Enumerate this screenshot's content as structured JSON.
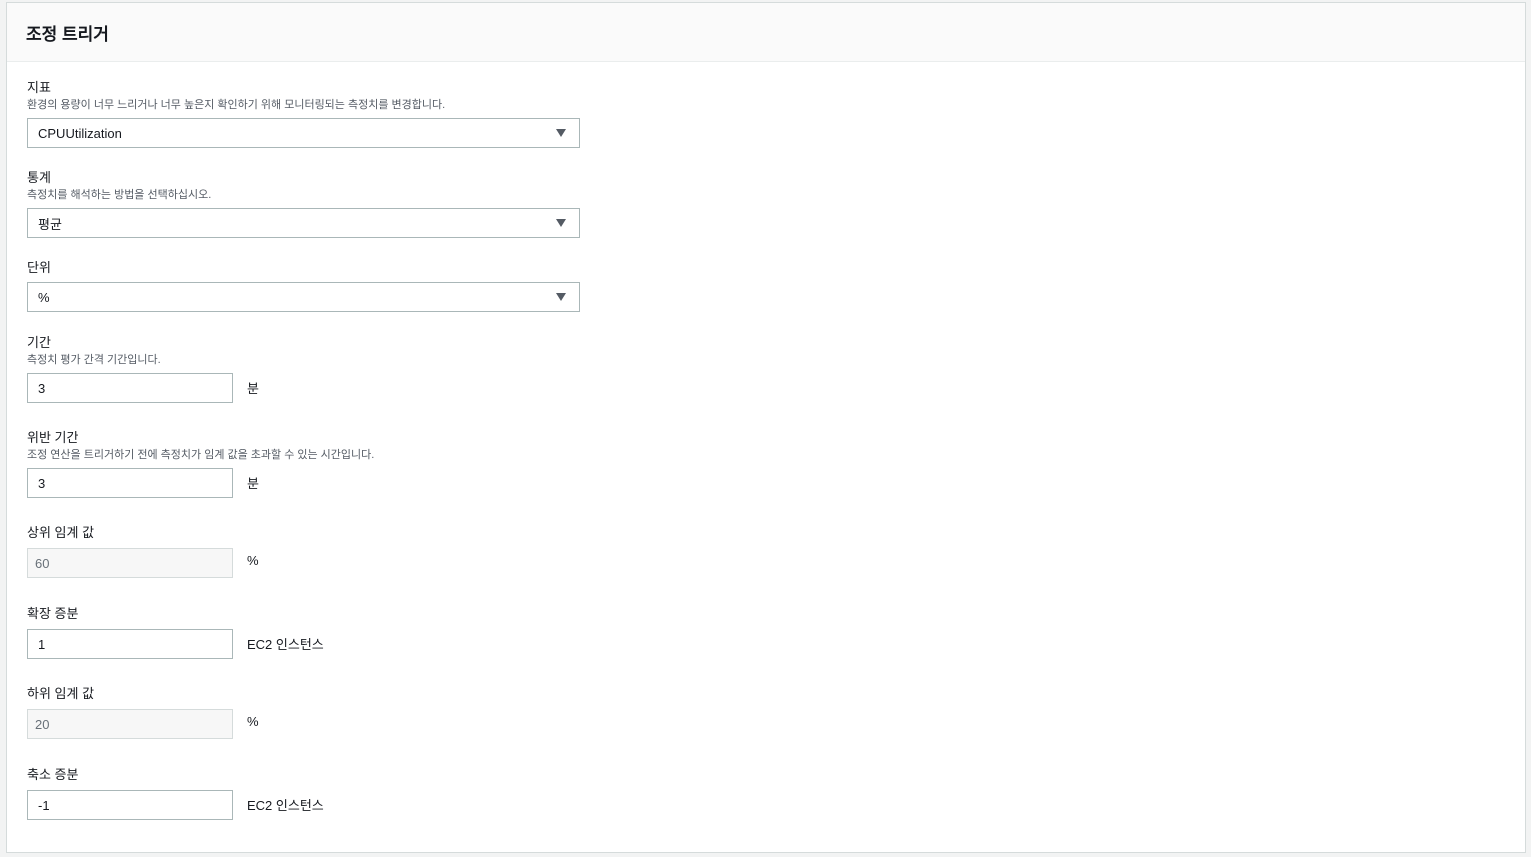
{
  "panel": {
    "title": "조정 트리거"
  },
  "metric": {
    "label": "지표",
    "description": "환경의 용량이 너무 느리거나 너무 높은지 확인하기 위해 모니터링되는 측정치를 변경합니다.",
    "value": "CPUUtilization"
  },
  "statistic": {
    "label": "통계",
    "description": "측정치를 해석하는 방법을 선택하십시오.",
    "value": "평균"
  },
  "unit": {
    "label": "단위",
    "value": "%"
  },
  "period": {
    "label": "기간",
    "description": "측정치 평가 간격 기간입니다.",
    "value": "3",
    "suffix": "분"
  },
  "breach_duration": {
    "label": "위반 기간",
    "description": "조정 연산을 트리거하기 전에 측정치가 임계 값을 초과할 수 있는 시간입니다.",
    "value": "3",
    "suffix": "분"
  },
  "upper_threshold": {
    "label": "상위 임계 값",
    "value": "60",
    "suffix": "%"
  },
  "scale_up": {
    "label": "확장 증분",
    "value": "1",
    "suffix": "EC2 인스턴스"
  },
  "lower_threshold": {
    "label": "하위 임계 값",
    "value": "20",
    "suffix": "%"
  },
  "scale_down": {
    "label": "축소 증분",
    "value": "-1",
    "suffix": "EC2 인스턴스"
  }
}
